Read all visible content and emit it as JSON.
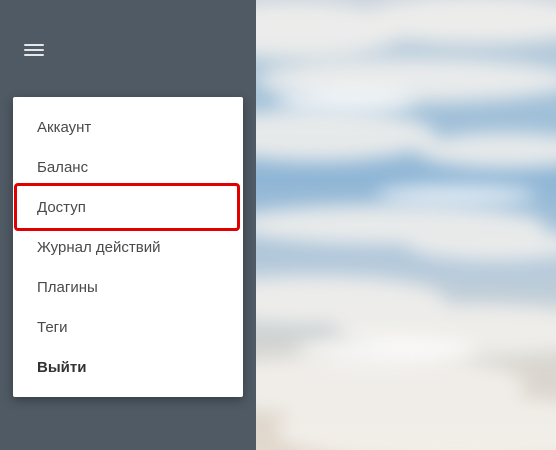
{
  "sidebar": {
    "menu_icon": "hamburger-menu-icon",
    "background_color": "#505a64"
  },
  "menu": {
    "items": [
      {
        "label": "Аккаунт"
      },
      {
        "label": "Баланс"
      },
      {
        "label": "Доступ"
      },
      {
        "label": "Журнал действий"
      },
      {
        "label": "Плагины"
      },
      {
        "label": "Теги"
      },
      {
        "label": "Выйти"
      }
    ],
    "highlighted_item": "Доступ",
    "highlight_color": "#e00000"
  }
}
